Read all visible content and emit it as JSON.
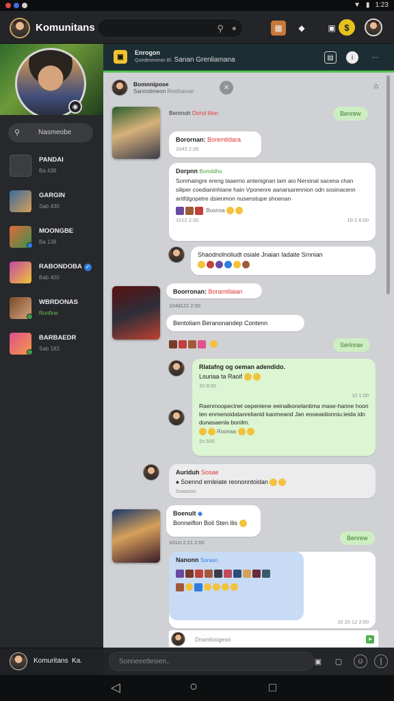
{
  "status_bar": {
    "time": "1:23"
  },
  "topbar": {
    "app_title": "Komunitans",
    "icons": [
      "book-icon",
      "gamepad-icon",
      "window-icon"
    ],
    "coin_label": "$"
  },
  "sidebar": {
    "search_label": "Nasmeobe",
    "items": [
      {
        "name": "PANDAI",
        "sub": "Ba 438",
        "thumb": "#3b3d41"
      },
      {
        "name": "GARGIN",
        "sub": "Sab 430",
        "thumb": "#5c7fa0"
      },
      {
        "name": "MOONGBE",
        "sub": "Ba 138",
        "thumb": "#9b5b3c"
      },
      {
        "name": "RABONDOBA",
        "sub": "Bab 400",
        "thumb": "#7d4a8c"
      },
      {
        "name": "WBRDONAS",
        "sub": "Ronfine",
        "thumb": "#a56d3a"
      },
      {
        "name": "BARBAEDR",
        "sub": "Sab 183",
        "thumb": "#c04a5a"
      }
    ],
    "footer_name": "Komuritans",
    "footer_suffix": "Ka."
  },
  "chat_header": {
    "line1": "Enrogon",
    "line2": "Sanan Grenliamana",
    "line2_prefix": "Quedeomoran Bl."
  },
  "pinned": {
    "name": "Bomnnipose",
    "sub": "Sannotimeon",
    "sub_tag": "Resfoanoe"
  },
  "messages": {
    "m1_label": "Benmoh",
    "m1_tag": "Dorol liinn",
    "m1_chip": "Benrew",
    "m2_name": "Borornan:",
    "m2_tag": "Boremtidara",
    "m2_time": "1043 2:26",
    "m3_title": "Dorpnn",
    "m3_tag": "Bomiidhs",
    "m3_body": "Sonmaingre ereng taaerno antenignan lam aio Nersinal sacena chan siliper coedianinhiane hain Vponenre aanarsarennion odn sosinacenn aritfdgopetre dsienmon nusenstupe shoenan",
    "m3_footer": "Bosnoa",
    "m3_time_l": "1012 2:30",
    "m3_time_r": "10-2 6:00",
    "m4_text": "Shaodnolnoliudt osiale Jnaian Iadaite Srnnian",
    "m5_name": "Boorronan:",
    "m5_tag": "Boramtilaian",
    "m5_time": "104d121 2:00",
    "m6_text": "Bentoliam Beranonandep Contenn",
    "m7_chip": "Serlnrav",
    "m8_line1": "Rlatafng og oeman adendido.",
    "m8_line2": "Lsuriaa ta Raoif",
    "m8_time_l": "10 8:00",
    "m8_time_r": "10 1:00",
    "m9_text": "Raenmoopecinel oepeniene eeinalkonelantima mase-hanne hoon ten enmenoidatanrelianid kaomeand Jan eooeaidionniu:ieida idn dunasaenla bonilm.",
    "m9_footer": "Roonaa",
    "m9_time": "2n 500",
    "m10_name": "Auriduh",
    "m10_tag": "Sosae",
    "m10_text": "Soennd emleiate reononntoidan",
    "m10_sub": "Soaseon",
    "m11_name": "Boenult",
    "m11_text": "Bonneiflon Boil Sten llis",
    "m11_time": "101ct 2:21 2:00",
    "m12_chip": "Benrew",
    "m13_title": "Nanonn",
    "m13_tag": "Sorasn",
    "m13_time": "10 20 12 2:00",
    "composer_placeholder": "Dnamloogesn"
  },
  "bottom_input": {
    "placeholder": "Sonneeetlesien.."
  },
  "nav": {
    "back": "◁",
    "home": "○",
    "recent": "□"
  },
  "colors": {
    "accent": "#54c14f",
    "coin": "#e6c21c",
    "red_text": "#d33333"
  }
}
